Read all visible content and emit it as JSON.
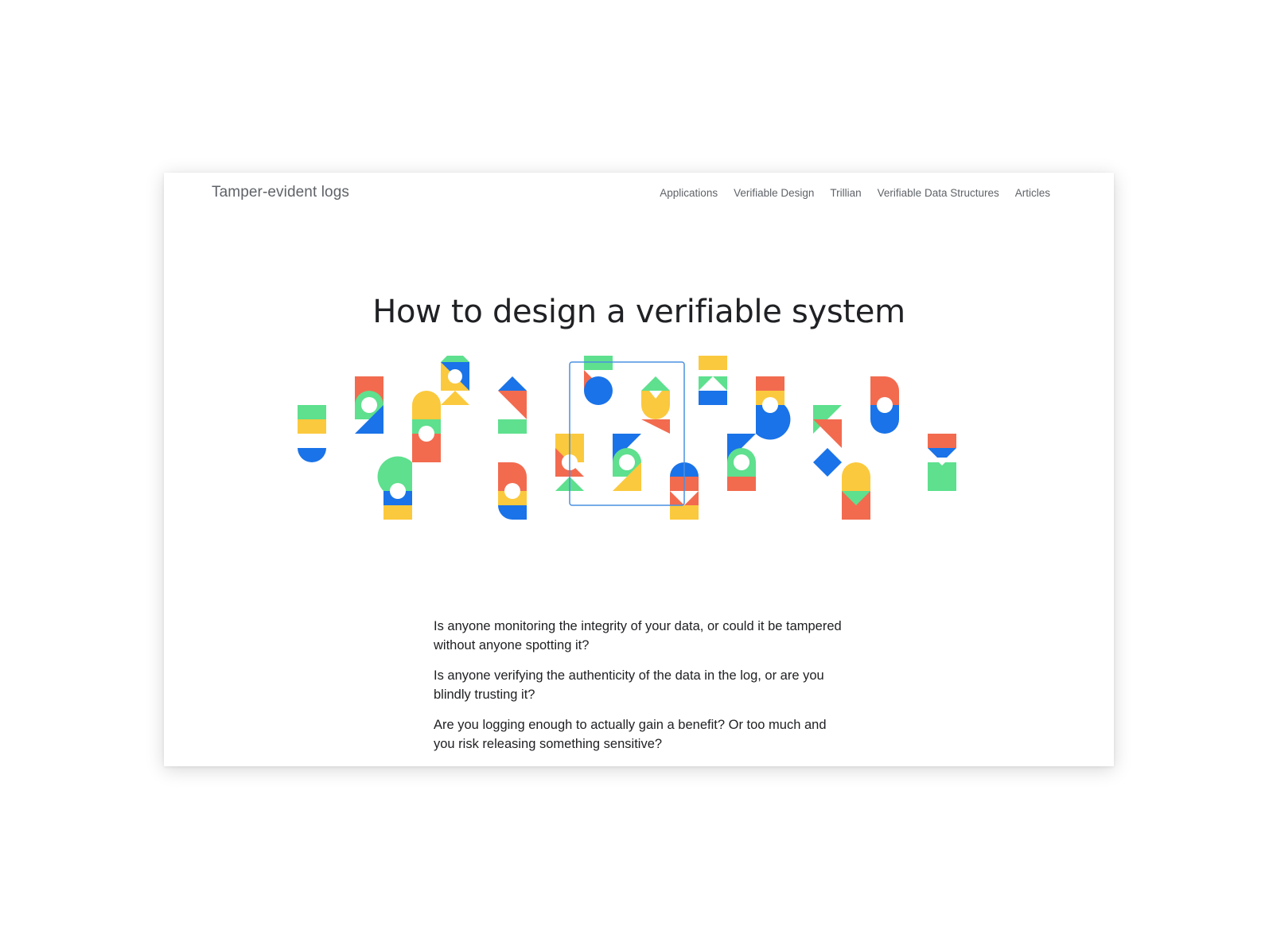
{
  "header": {
    "brand": "Tamper-evident logs",
    "nav": [
      "Applications",
      "Verifiable Design",
      "Trillian",
      "Verifiable Data Structures",
      "Articles"
    ]
  },
  "main": {
    "title": "How to design a verifiable system",
    "paragraphs": [
      "Is anyone monitoring the integrity of your data, or could it be tampered without anyone spotting it?",
      "Is anyone verifying the authenticity of the data in the log, or are you blindly trusting it?",
      "Are you logging enough to actually gain a benefit? Or too much and you risk releasing something sensitive?"
    ]
  },
  "colors": {
    "red": "#f26b4f",
    "yellow": "#fbc93d",
    "green": "#5ee08e",
    "blue": "#1a73e8",
    "highlight_outline": "#4a90e2"
  },
  "illustration": {
    "name": "colorful-geometric-glyphs"
  }
}
